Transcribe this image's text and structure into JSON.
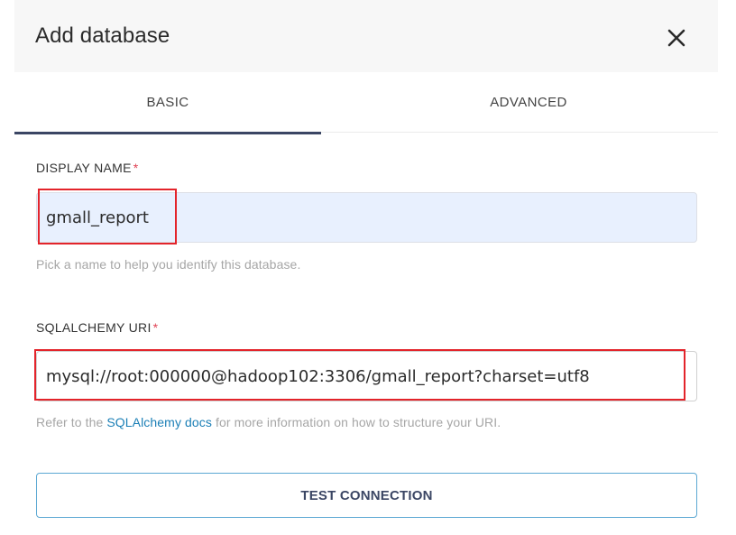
{
  "dialog": {
    "title": "Add database",
    "close_icon": "close-icon"
  },
  "tabs": [
    {
      "label": "BASIC",
      "active": true
    },
    {
      "label": "ADVANCED",
      "active": false
    }
  ],
  "display_name": {
    "label": "DISPLAY NAME",
    "required_mark": "*",
    "value": "gmall_report",
    "help": "Pick a name to help you identify this database."
  },
  "sqlalchemy_uri": {
    "label": "SQLALCHEMY URI",
    "required_mark": "*",
    "value": "mysql://root:000000@hadoop102:3306/gmall_report?charset=utf8",
    "help_prefix": "Refer to the ",
    "help_link": "SQLAlchemy docs",
    "help_suffix": " for more information on how to structure your URI."
  },
  "test_connection_label": "TEST CONNECTION",
  "colors": {
    "accent": "#3b4664",
    "link": "#1b7fb6",
    "required": "#e04355",
    "highlight": "#e3242b",
    "autofill_bg": "#e8f0fe"
  }
}
